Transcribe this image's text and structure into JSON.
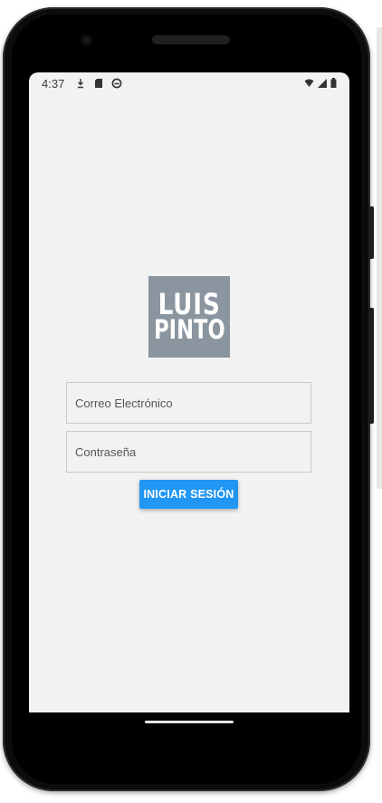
{
  "status_bar": {
    "time": "4:37",
    "icons_left": [
      "download-icon",
      "sd-card-icon",
      "sync-icon"
    ],
    "icons_right": [
      "wifi-icon",
      "cell-signal-icon",
      "battery-icon"
    ]
  },
  "logo": {
    "line1": "LUIS",
    "line2": "PINTO",
    "background": "#8a95a0"
  },
  "login_form": {
    "email_placeholder": "Correo Electrónico",
    "password_placeholder": "Contraseña",
    "submit_label": "INICIAR SESIÓN"
  },
  "colors": {
    "accent": "#2196f3",
    "screen_bg": "#f2f2f2"
  }
}
